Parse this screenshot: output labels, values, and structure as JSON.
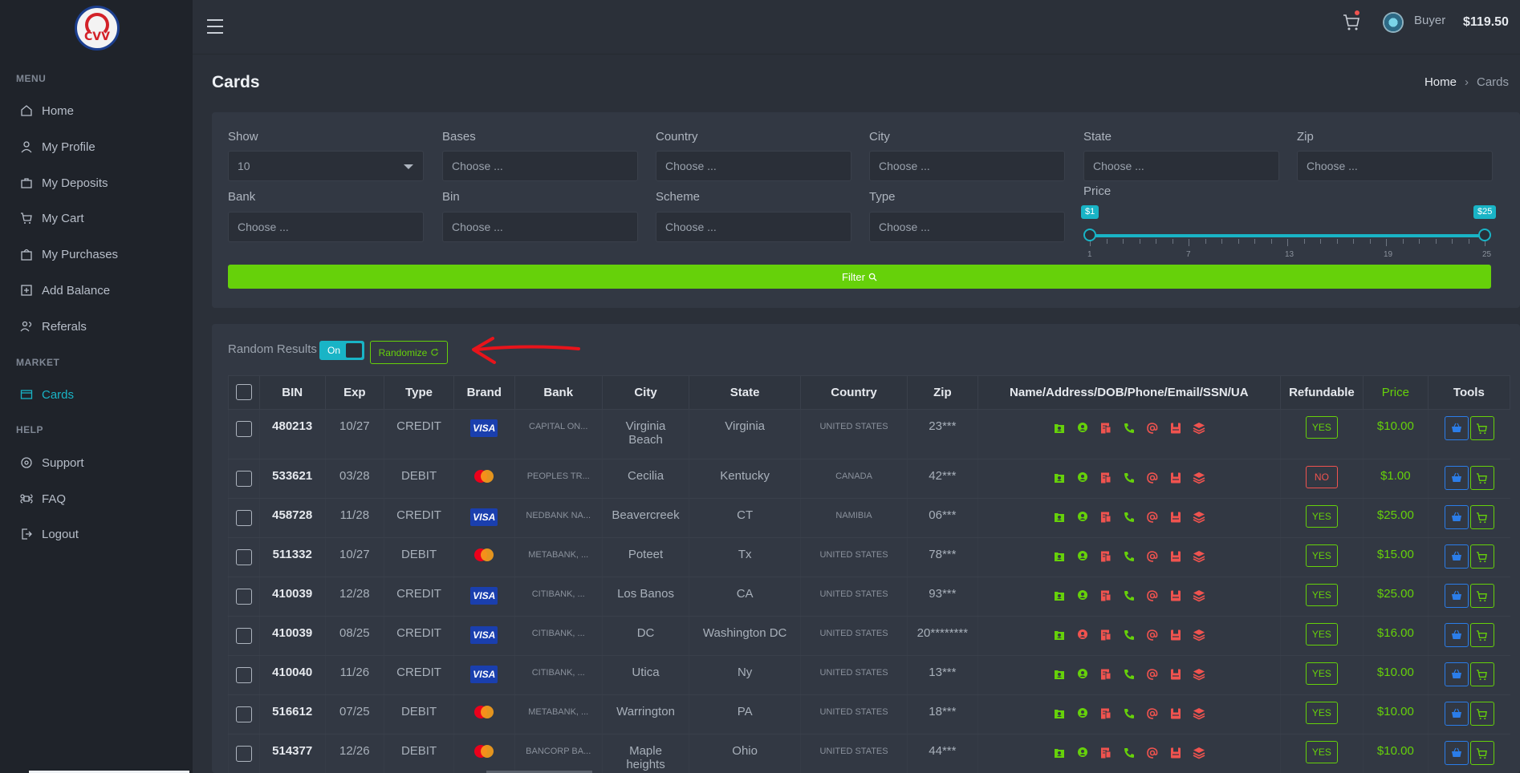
{
  "app": {
    "logo_text": "CVV"
  },
  "sidebar": {
    "sections": [
      {
        "title": "MENU"
      },
      {
        "title": "MARKET"
      },
      {
        "title": "HELP"
      }
    ],
    "items": [
      {
        "label": "Home",
        "icon": "home-icon"
      },
      {
        "label": "My Profile",
        "icon": "user-icon"
      },
      {
        "label": "My Deposits",
        "icon": "briefcase-icon"
      },
      {
        "label": "My Cart",
        "icon": "cart-icon"
      },
      {
        "label": "My Purchases",
        "icon": "bag-icon"
      },
      {
        "label": "Add Balance",
        "icon": "plus-square-icon"
      },
      {
        "label": "Referals",
        "icon": "users-icon"
      },
      {
        "label": "Cards",
        "icon": "card-icon",
        "active": true
      },
      {
        "label": "Support",
        "icon": "support-icon"
      },
      {
        "label": "FAQ",
        "icon": "command-icon"
      },
      {
        "label": "Logout",
        "icon": "logout-icon"
      }
    ]
  },
  "header": {
    "user_role": "Buyer",
    "balance": "$119.50"
  },
  "page": {
    "title": "Cards",
    "breadcrumb": {
      "home": "Home",
      "sep": "›",
      "current": "Cards"
    }
  },
  "filters": {
    "show": {
      "label": "Show",
      "value": "10"
    },
    "bases": {
      "label": "Bases",
      "placeholder": "Choose ..."
    },
    "country": {
      "label": "Country",
      "placeholder": "Choose ..."
    },
    "city": {
      "label": "City",
      "placeholder": "Choose ..."
    },
    "state": {
      "label": "State",
      "placeholder": "Choose ..."
    },
    "zip": {
      "label": "Zip",
      "placeholder": "Choose ..."
    },
    "bank": {
      "label": "Bank",
      "placeholder": "Choose ..."
    },
    "bin": {
      "label": "Bin",
      "placeholder": "Choose ..."
    },
    "scheme": {
      "label": "Scheme",
      "placeholder": "Choose ..."
    },
    "type": {
      "label": "Type",
      "placeholder": "Choose ..."
    },
    "price": {
      "label": "Price",
      "min_tag": "$1",
      "max_tag": "$25",
      "min": 1,
      "max": 25,
      "tick_labels": [
        "1",
        "7",
        "13",
        "19",
        "25"
      ]
    },
    "filter_button": "Filter"
  },
  "results": {
    "random_label": "Random Results",
    "toggle_label": "On",
    "randomize_label": "Randomize",
    "columns": [
      "BIN",
      "Exp",
      "Type",
      "Brand",
      "Bank",
      "City",
      "State",
      "Country",
      "Zip",
      "Name/Address/DOB/Phone/Email/SSN/UA",
      "Refundable",
      "Price",
      "Tools"
    ],
    "rows": [
      {
        "bin": "480213",
        "exp": "10/27",
        "type": "CREDIT",
        "brand": "VISA",
        "bank": "CAPITAL ON...",
        "city": "Virginia Beach",
        "state": "Virginia",
        "country": "UNITED STATES",
        "zip": "23***",
        "refundable": "YES",
        "price": "$10.00"
      },
      {
        "bin": "533621",
        "exp": "03/28",
        "type": "DEBIT",
        "brand": "MASTERCARD",
        "bank": "PEOPLES TR...",
        "city": "Cecilia",
        "state": "Kentucky",
        "country": "CANADA",
        "zip": "42***",
        "refundable": "NO",
        "price": "$1.00"
      },
      {
        "bin": "458728",
        "exp": "11/28",
        "type": "CREDIT",
        "brand": "VISA",
        "bank": "NEDBANK NA...",
        "city": "Beavercreek",
        "state": "CT",
        "country": "NAMIBIA",
        "zip": "06***",
        "refundable": "YES",
        "price": "$25.00"
      },
      {
        "bin": "511332",
        "exp": "10/27",
        "type": "DEBIT",
        "brand": "MASTERCARD",
        "bank": "METABANK, ...",
        "city": "Poteet",
        "state": "Tx",
        "country": "UNITED STATES",
        "zip": "78***",
        "refundable": "YES",
        "price": "$15.00"
      },
      {
        "bin": "410039",
        "exp": "12/28",
        "type": "CREDIT",
        "brand": "VISA",
        "bank": "CITIBANK, ...",
        "city": "Los Banos",
        "state": "CA",
        "country": "UNITED STATES",
        "zip": "93***",
        "refundable": "YES",
        "price": "$25.00"
      },
      {
        "bin": "410039",
        "exp": "08/25",
        "type": "CREDIT",
        "brand": "VISA",
        "bank": "CITIBANK, ...",
        "city": "DC",
        "state": "Washington DC",
        "country": "UNITED STATES",
        "zip": "20********",
        "refundable": "YES",
        "price": "$16.00"
      },
      {
        "bin": "410040",
        "exp": "11/26",
        "type": "CREDIT",
        "brand": "VISA",
        "bank": "CITIBANK, ...",
        "city": "Utica",
        "state": "Ny",
        "country": "UNITED STATES",
        "zip": "13***",
        "refundable": "YES",
        "price": "$10.00"
      },
      {
        "bin": "516612",
        "exp": "07/25",
        "type": "DEBIT",
        "brand": "MASTERCARD",
        "bank": "METABANK, ...",
        "city": "Warrington",
        "state": "PA",
        "country": "UNITED STATES",
        "zip": "18***",
        "refundable": "YES",
        "price": "$10.00"
      },
      {
        "bin": "514377",
        "exp": "12/26",
        "type": "DEBIT",
        "brand": "MASTERCARD",
        "bank": "BANCORP BA...",
        "city": "Maple heights",
        "state": "Ohio",
        "country": "UNITED STATES",
        "zip": "44***",
        "refundable": "YES",
        "price": "$10.00"
      }
    ],
    "info_icons": [
      "contact-card-icon",
      "location-pin-icon",
      "id-document-icon",
      "phone-icon",
      "at-email-icon",
      "ssn-badge-icon",
      "stack-layers-icon"
    ]
  },
  "colors": {
    "accent": "#19b4c6",
    "green": "#66d10a",
    "red": "#f0534f",
    "blue": "#2b7de9"
  }
}
